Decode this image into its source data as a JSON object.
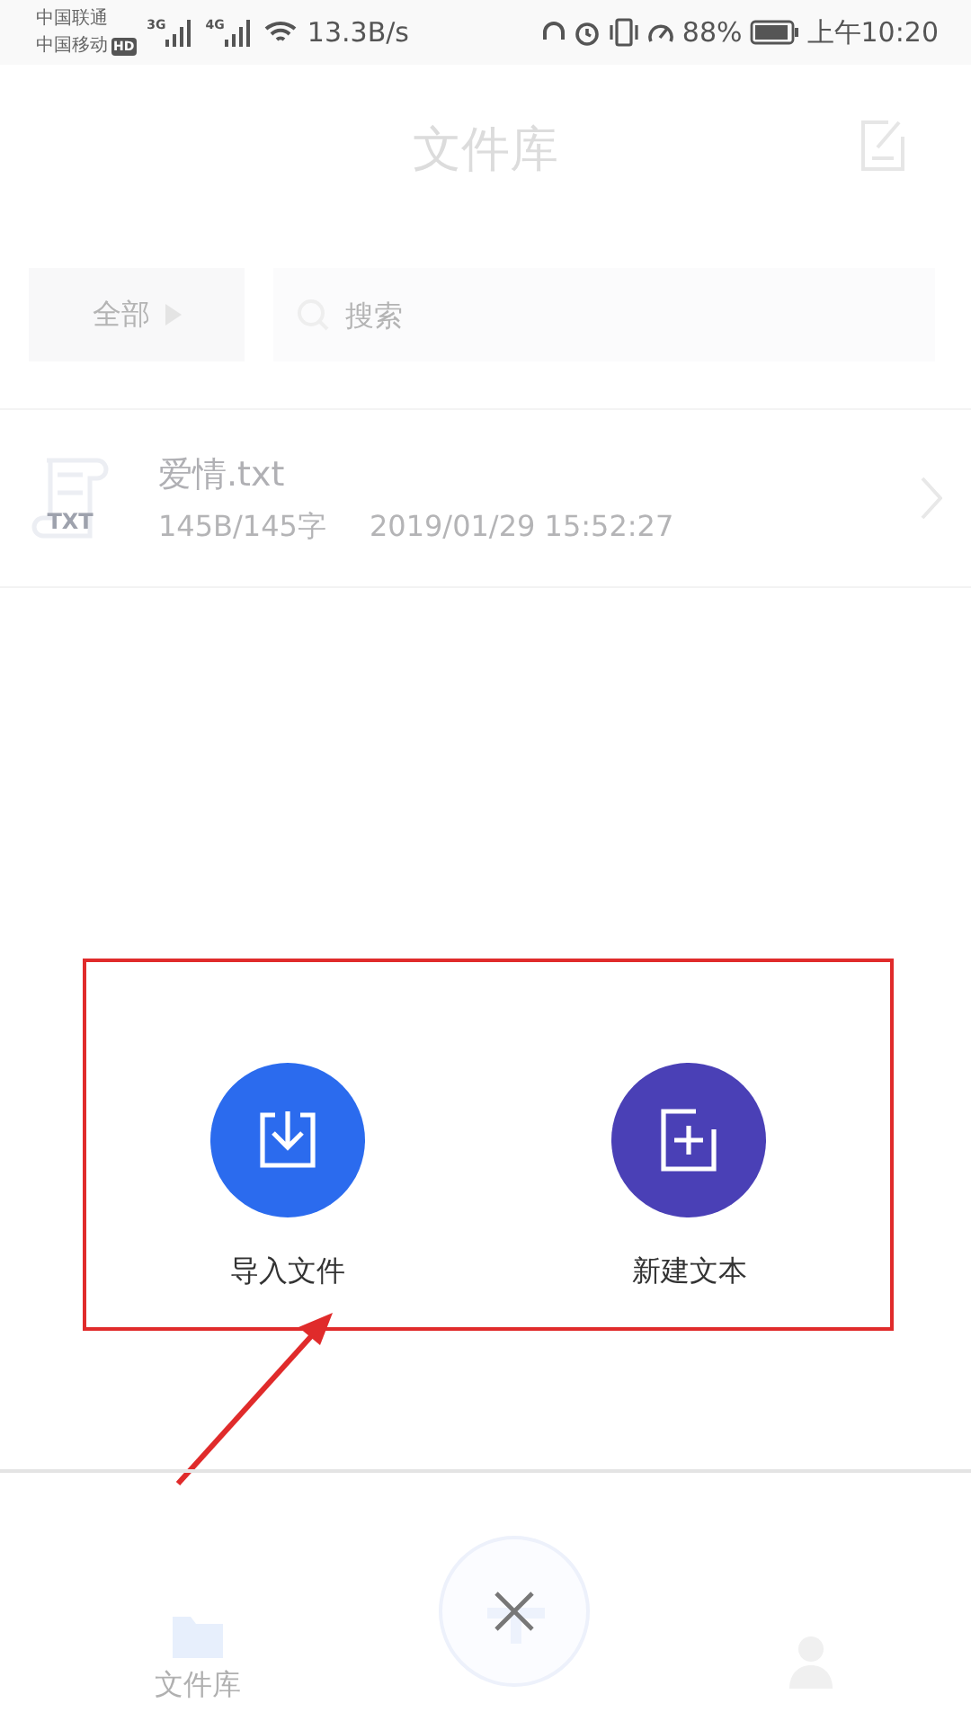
{
  "status_bar": {
    "carrier_1": "中国联通",
    "carrier_2": "中国移动",
    "hd_badge": "HD",
    "net_1": "3G",
    "net_2": "4G",
    "speed": "13.3B/s",
    "battery": "88%",
    "time": "上午10:20"
  },
  "header": {
    "title": "文件库"
  },
  "filter": {
    "dropdown": "全部",
    "search": {
      "placeholder": "搜索"
    }
  },
  "files": [
    {
      "name": "爱情.txt",
      "size": "145B/145字",
      "modified": "2019/01/29 15:52:27",
      "type_badge": "TXT"
    }
  ],
  "menu": {
    "actions": [
      {
        "kind": "import",
        "label": "导入文件",
        "color": "#2b6bee"
      },
      {
        "kind": "new",
        "label": "新建文本",
        "color": "#4a40b6"
      }
    ]
  },
  "bottom_nav": {
    "items": [
      {
        "kind": "files",
        "label": "文件库"
      },
      {
        "kind": "close"
      },
      {
        "kind": "profile"
      }
    ]
  }
}
